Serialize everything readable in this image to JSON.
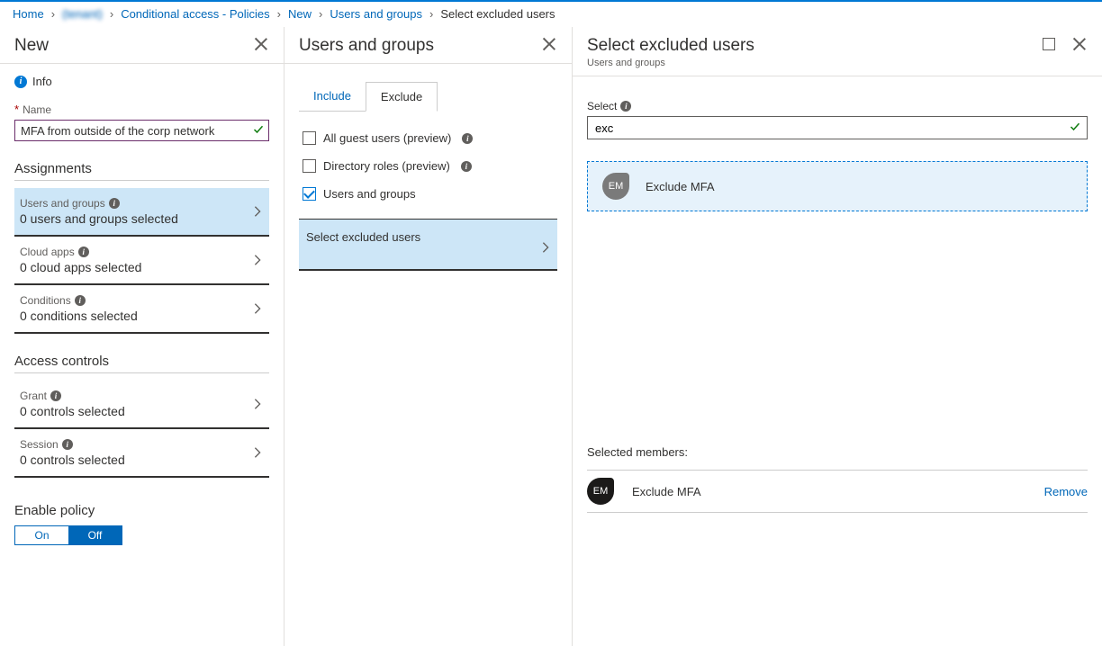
{
  "breadcrumb": {
    "home": "Home",
    "tenant": "(tenant)",
    "policies": "Conditional access - Policies",
    "new": "New",
    "usersgroups": "Users and groups",
    "current": "Select excluded users"
  },
  "blade1": {
    "title": "New",
    "info": "Info",
    "name_label": "Name",
    "name_value": "MFA from outside of the corp network",
    "assignments_h": "Assignments",
    "items": [
      {
        "title": "Users and groups",
        "value": "0 users and groups selected",
        "selected": true,
        "info": true
      },
      {
        "title": "Cloud apps",
        "value": "0 cloud apps selected",
        "selected": false,
        "info": true
      },
      {
        "title": "Conditions",
        "value": "0 conditions selected",
        "selected": false,
        "info": true
      }
    ],
    "access_h": "Access controls",
    "access": [
      {
        "title": "Grant",
        "value": "0 controls selected",
        "info": true
      },
      {
        "title": "Session",
        "value": "0 controls selected",
        "info": true
      }
    ],
    "enable_h": "Enable policy",
    "toggle": {
      "on": "On",
      "off": "Off"
    }
  },
  "blade2": {
    "title": "Users and groups",
    "tabs": {
      "include": "Include",
      "exclude": "Exclude"
    },
    "checks": {
      "guest": "All guest users (preview)",
      "roles": "Directory roles (preview)",
      "ug": "Users and groups"
    },
    "select_excluded": "Select excluded users"
  },
  "blade3": {
    "title": "Select excluded users",
    "subtitle": "Users and groups",
    "select_label": "Select",
    "search_value": "exc",
    "result": {
      "avatar": "EM",
      "name": "Exclude MFA"
    },
    "selected_h": "Selected members:",
    "member": {
      "avatar": "EM",
      "name": "Exclude MFA",
      "remove": "Remove"
    }
  }
}
